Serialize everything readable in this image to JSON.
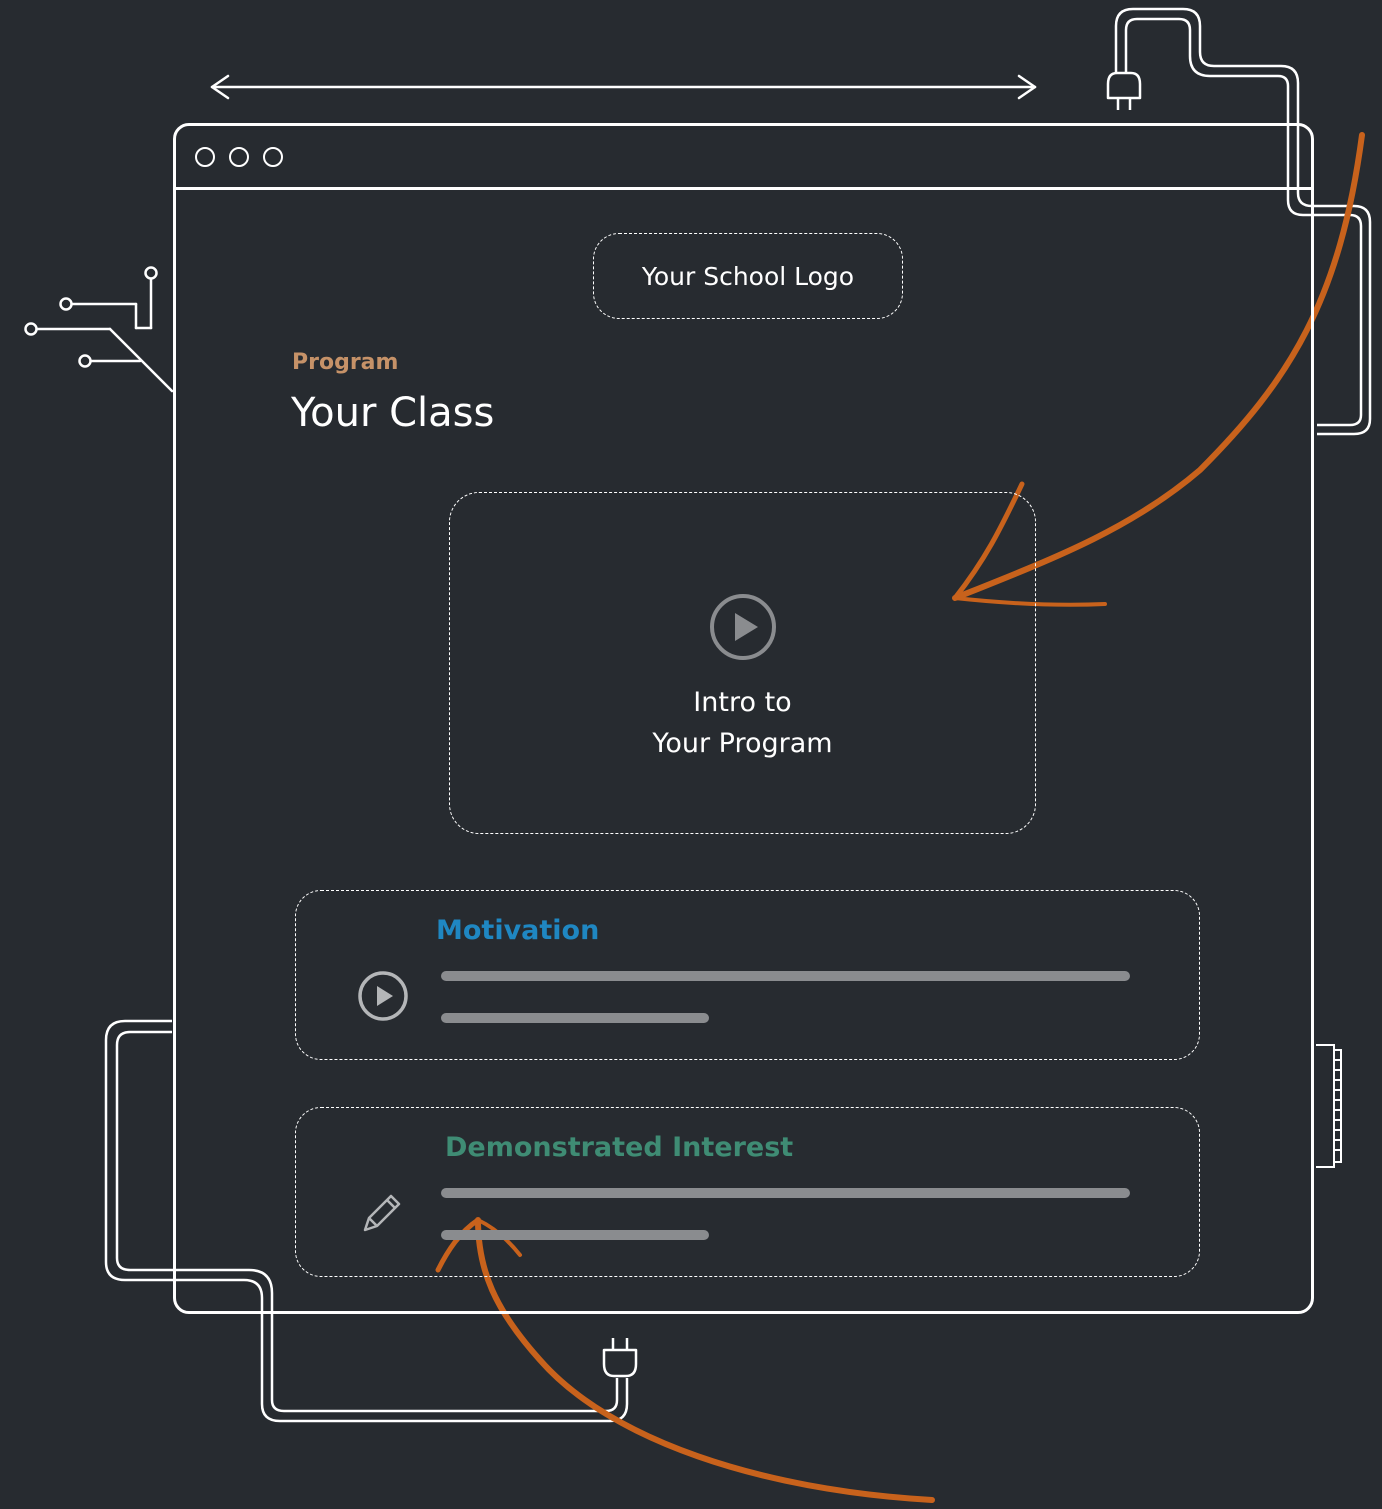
{
  "logo": {
    "label": "Your School Logo"
  },
  "header": {
    "eyebrow": "Program",
    "title": "Your Class"
  },
  "video": {
    "line1": "Intro to",
    "line2": "Your Program",
    "icon": "play-circle-icon"
  },
  "cards": [
    {
      "title": "Motivation",
      "color": "#1f87c2",
      "icon": "play-circle-icon"
    },
    {
      "title": "Demonstrated Interest",
      "color": "#3f8c74",
      "icon": "pencil-icon"
    }
  ],
  "colors": {
    "background": "#272b30",
    "outline": "#ffffff",
    "accent_arrow": "#c8621c",
    "eyebrow": "#c69268",
    "placeholder_bar": "#8a8c8f"
  }
}
